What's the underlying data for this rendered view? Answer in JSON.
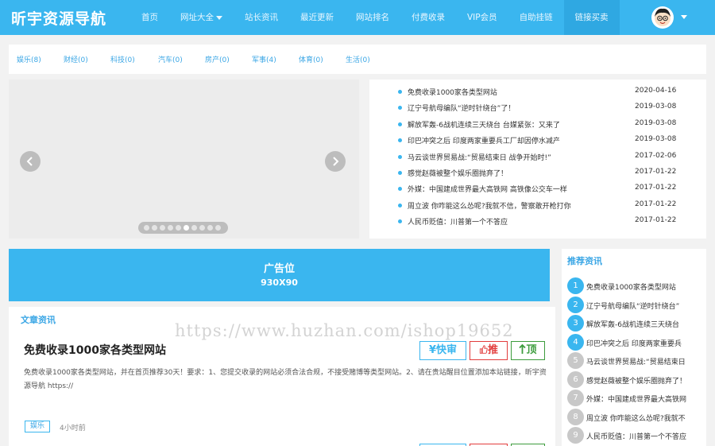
{
  "header": {
    "logo": "昕宇资源导航",
    "nav": [
      "首页",
      "网址大全",
      "站长资讯",
      "最近更新",
      "网站排名",
      "付费收录",
      "VIP会员",
      "自助挂链",
      "链接买卖"
    ]
  },
  "categories": [
    "娱乐(8)",
    "财经(0)",
    "科技(0)",
    "汽车(0)",
    "房产(0)",
    "军事(4)",
    "体育(0)",
    "生活(0)"
  ],
  "slider": {
    "slide_count": 10,
    "active_index": 5
  },
  "news": [
    {
      "title": "免费收录1000家各类型网站",
      "date": "2020-04-16"
    },
    {
      "title": "辽宁号航母编队“逆时针绕台”了！",
      "date": "2019-03-08"
    },
    {
      "title": "解放军轰-6战机连续三天绕台 台媒紧张：又来了",
      "date": "2019-03-08"
    },
    {
      "title": "印巴冲突之后 印度两家重要兵工厂却因停水减产",
      "date": "2019-03-08"
    },
    {
      "title": "马云谈世界贸易战:“贸易结束日 战争开始时!”",
      "date": "2017-02-06"
    },
    {
      "title": "感觉赵薇被整个娱乐圈抛弃了！",
      "date": "2017-01-22"
    },
    {
      "title": "外媒：中国建成世界最大高铁网 高铁像公交车一样",
      "date": "2017-01-22"
    },
    {
      "title": "周立波 你咋能这么怂呢?我就不信，警察敢开枪打你",
      "date": "2017-01-22"
    },
    {
      "title": "人民币贬值：川普第一个不答应",
      "date": "2017-01-22"
    }
  ],
  "ad": {
    "title": "广告位",
    "size": "930X90"
  },
  "articles": {
    "section_title": "文章资讯",
    "item": {
      "title": "免费收录1000家各类型网站",
      "desc": "免费收录1000家各类型网站，并在首页推荐30天！要求：1、您提交收录的网站必须合法合规，不接受赌博等类型网站。2、请在贵站醒目位置添加本站链接，昕宇资源导航  https://",
      "tag": "娱乐",
      "time": "4小时前",
      "btn_fast": "¥快审",
      "btn_rec": "推",
      "btn_top": "顶"
    }
  },
  "watermark": "https://www.huzhan.com/ishop19652",
  "recommend": {
    "title": "推荐资讯",
    "items": [
      {
        "num": "1",
        "title": "免费收录1000家各类型网站"
      },
      {
        "num": "2",
        "title": "辽宁号航母编队“逆时针绕台”"
      },
      {
        "num": "3",
        "title": "解放军轰-6战机连续三天绕台"
      },
      {
        "num": "4",
        "title": "印巴冲突之后 印度两家重要兵"
      },
      {
        "num": "5",
        "title": "马云谈世界贸易战:“贸易结束日"
      },
      {
        "num": "6",
        "title": "感觉赵薇被整个娱乐圈抛弃了！"
      },
      {
        "num": "7",
        "title": "外媒：中国建成世界最大高铁网"
      },
      {
        "num": "8",
        "title": "周立波 你咋能这么怂呢?我就不"
      },
      {
        "num": "9",
        "title": "人民币贬值：川普第一个不答应"
      }
    ]
  },
  "colors": {
    "accent": "#3ab6ef",
    "rec_highlight": "#3ab6ef",
    "rec_muted": "#c8c8c8",
    "recommend_red": "#e23d3d",
    "top_green": "#3d9c3d"
  }
}
